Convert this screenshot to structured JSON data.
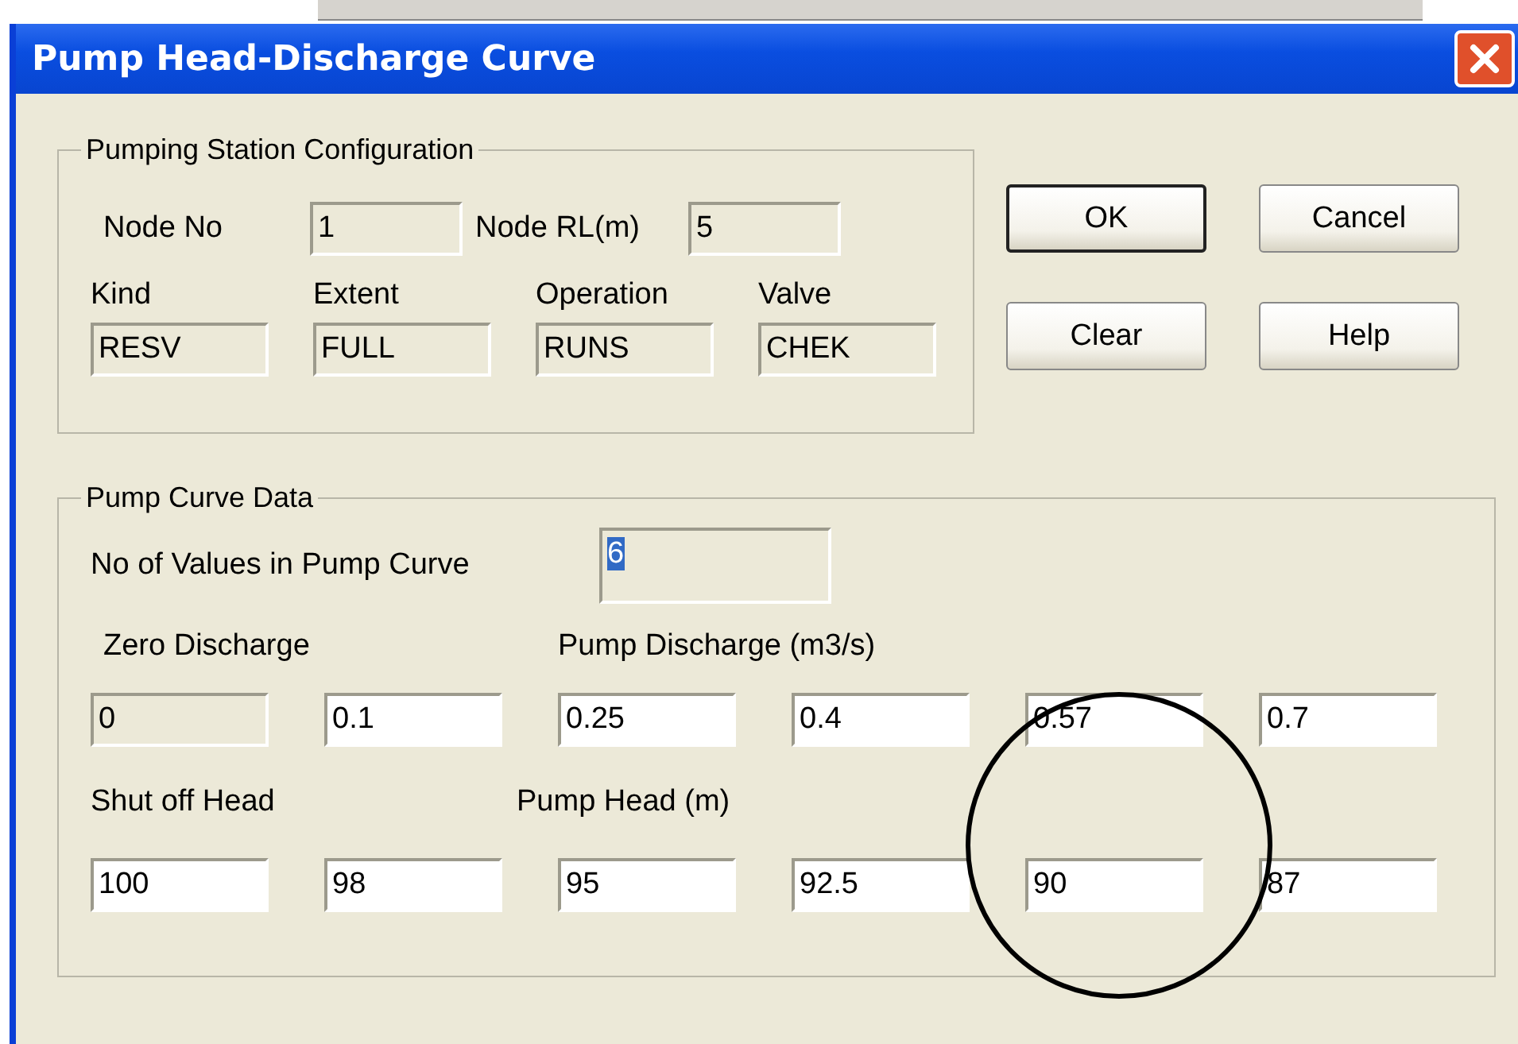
{
  "window": {
    "title": "Pump Head-Discharge Curve"
  },
  "station": {
    "title": "Pumping Station Configuration",
    "inline_fields": [
      {
        "label": "Node No",
        "value": "1",
        "readonly": true
      },
      {
        "label": "Node RL(m)",
        "value": "5",
        "readonly": true
      }
    ],
    "stacked_fields": [
      {
        "label": "Kind",
        "value": "RESV",
        "readonly": true
      },
      {
        "label": "Extent",
        "value": "FULL",
        "readonly": true
      },
      {
        "label": "Operation",
        "value": "RUNS",
        "readonly": true
      },
      {
        "label": "Valve",
        "value": "CHEK",
        "readonly": true
      }
    ]
  },
  "buttons": [
    {
      "label": "OK",
      "default": true
    },
    {
      "label": "Cancel",
      "default": false
    },
    {
      "label": "Clear",
      "default": false
    },
    {
      "label": "Help",
      "default": false
    }
  ],
  "pump_curve": {
    "title": "Pump Curve Data",
    "count": {
      "label": "No of Values in Pump Curve",
      "value": "6",
      "readonly": true,
      "selected": true
    },
    "discharge_labels": [
      "Zero Discharge",
      "Pump Discharge (m3/s)"
    ],
    "discharge": [
      {
        "value": "0",
        "readonly": true
      },
      {
        "value": "0.1",
        "readonly": false
      },
      {
        "value": "0.25",
        "readonly": false
      },
      {
        "value": "0.4",
        "readonly": false
      },
      {
        "value": "0.57",
        "readonly": false
      },
      {
        "value": "0.7",
        "readonly": false
      }
    ],
    "head_labels": [
      "Shut off Head",
      "Pump Head (m)"
    ],
    "head": [
      {
        "value": "100",
        "readonly": false
      },
      {
        "value": "98",
        "readonly": false
      },
      {
        "value": "95",
        "readonly": false
      },
      {
        "value": "92.5",
        "readonly": false
      },
      {
        "value": "90",
        "readonly": false
      },
      {
        "value": "87",
        "readonly": false
      }
    ]
  }
}
